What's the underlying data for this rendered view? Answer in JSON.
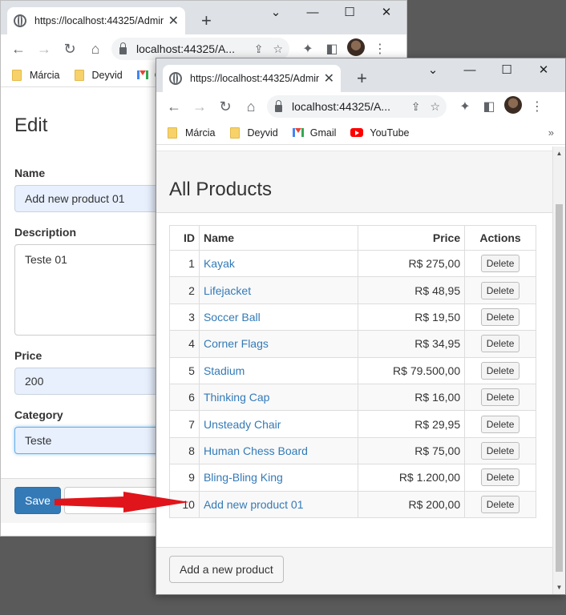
{
  "back_window": {
    "tab_title": "https://localhost:44325/Admin/",
    "url": "localhost:44325/A...",
    "bookmarks": [
      "Márcia",
      "Deyvid",
      "G"
    ],
    "page_title": "Edit",
    "fields": {
      "name_label": "Name",
      "name_value": "Add new product 01",
      "description_label": "Description",
      "description_value": "Teste 01",
      "price_label": "Price",
      "price_value": "200",
      "category_label": "Category",
      "category_value": "Teste"
    },
    "save_label": "Save"
  },
  "front_window": {
    "tab_title": "https://localhost:44325/Admin/",
    "url": "localhost:44325/A...",
    "bookmarks": {
      "marcia": "Márcia",
      "deyvid": "Deyvid",
      "gmail": "Gmail",
      "youtube": "YouTube"
    },
    "page_title": "All Products",
    "table": {
      "headers": {
        "id": "ID",
        "name": "Name",
        "price": "Price",
        "actions": "Actions"
      },
      "delete_label": "Delete",
      "rows": [
        {
          "id": "1",
          "name": "Kayak",
          "price": "R$ 275,00"
        },
        {
          "id": "2",
          "name": "Lifejacket",
          "price": "R$ 48,95"
        },
        {
          "id": "3",
          "name": "Soccer Ball",
          "price": "R$ 19,50"
        },
        {
          "id": "4",
          "name": "Corner Flags",
          "price": "R$ 34,95"
        },
        {
          "id": "5",
          "name": "Stadium",
          "price": "R$ 79.500,00"
        },
        {
          "id": "6",
          "name": "Thinking Cap",
          "price": "R$ 16,00"
        },
        {
          "id": "7",
          "name": "Unsteady Chair",
          "price": "R$ 29,95"
        },
        {
          "id": "8",
          "name": "Human Chess Board",
          "price": "R$ 75,00"
        },
        {
          "id": "9",
          "name": "Bling-Bling King",
          "price": "R$ 1.200,00"
        },
        {
          "id": "10",
          "name": "Add new product 01",
          "price": "R$ 200,00"
        }
      ]
    },
    "add_label": "Add a new product"
  },
  "colors": {
    "link": "#337ab7",
    "primary": "#337ab7",
    "arrow": "#e0141b"
  },
  "icons": [
    "globe-icon",
    "close-icon",
    "plus-icon",
    "back-icon",
    "forward-icon",
    "reload-icon",
    "home-icon",
    "lock-icon",
    "share-icon",
    "star-icon",
    "extensions-icon",
    "sidepanel-icon",
    "menu-icon",
    "minimize-icon",
    "maximize-icon",
    "folder-icon",
    "gmail-icon",
    "youtube-icon"
  ]
}
